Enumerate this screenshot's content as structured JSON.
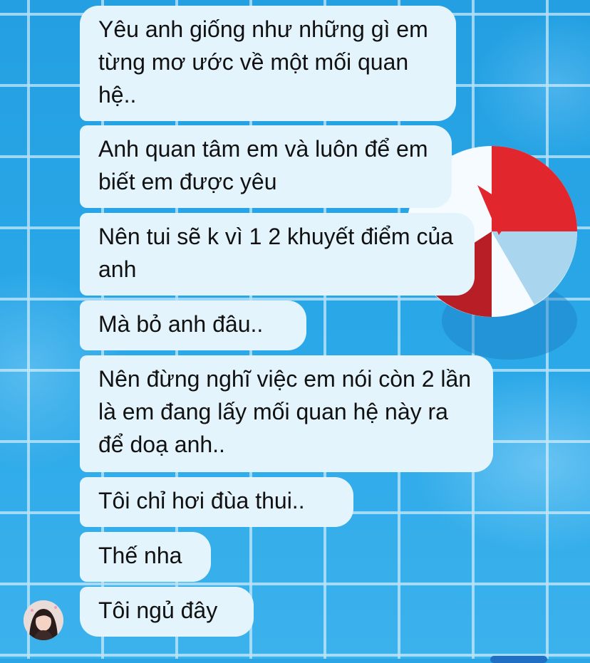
{
  "conversation": {
    "messages": [
      {
        "text": "Yêu anh giống như những gì em từng mơ ước về một mối quan hệ.."
      },
      {
        "text": "Anh quan tâm em và luôn để em biết em được yêu"
      },
      {
        "text": "Nên tui sẽ k vì 1 2 khuyết điểm của anh"
      },
      {
        "text": "Mà bỏ anh đâu.."
      },
      {
        "text": "Nên đừng nghĩ việc em nói còn 2 lần là em đang lấy mối quan hệ này ra để doạ anh.."
      },
      {
        "text": "Tôi chỉ hơi đùa thui.."
      },
      {
        "text": "Thế nha"
      },
      {
        "text": "Tôi ngủ đây"
      }
    ]
  },
  "background": {
    "theme": "swimming-pool-with-beach-ball",
    "colors": {
      "water": "#2aa6e6",
      "tile_lines": "#e1f5ff",
      "ball_red": "#e2262e",
      "ball_white": "#f6fbff",
      "bubble": "#e4f4fd"
    }
  },
  "avatar": {
    "icon": "user-avatar-icon"
  }
}
